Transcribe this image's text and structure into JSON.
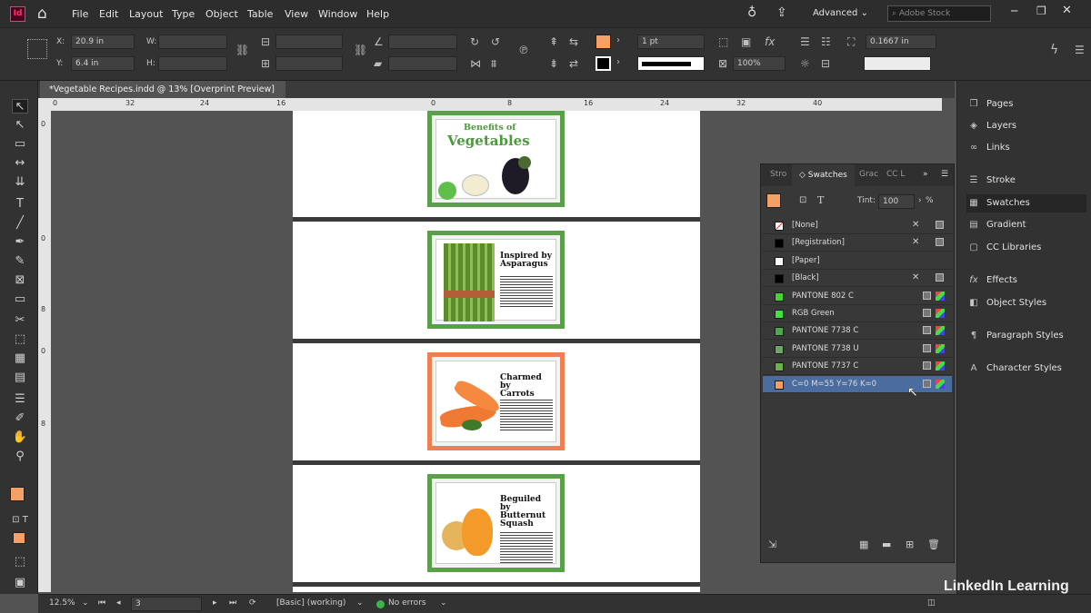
{
  "menubar": {
    "app_icon": "Id",
    "items": [
      "File",
      "Edit",
      "Layout",
      "Type",
      "Object",
      "Table",
      "View",
      "Window",
      "Help"
    ],
    "workspace": "Advanced",
    "search_placeholder": "Adobe Stock"
  },
  "control": {
    "x_label": "X:",
    "x_value": "20.9 in",
    "y_label": "Y:",
    "y_value": "6.4 in",
    "w_label": "W:",
    "h_label": "H:",
    "stroke_weight": "1 pt",
    "opacity": "100%",
    "inset": "0.1667 in",
    "fill_color": "#f7a066"
  },
  "document_tab": {
    "title": "*Vegetable Recipes.indd @ 13% [Overprint Preview]",
    "close": "×"
  },
  "ruler_h": [
    "0",
    "32",
    "24",
    "16",
    "0",
    "8",
    "16",
    "24",
    "32",
    "40"
  ],
  "ruler_v": [
    "0",
    "0",
    "8",
    "0",
    "8"
  ],
  "pages": [
    {
      "title_line1": "Benefits of",
      "title_line2": "Vegetables",
      "border": "#5aa04a"
    },
    {
      "title": "Inspired by Asparagus",
      "border": "#5aa04a"
    },
    {
      "title": "Charmed by Carrots",
      "border": "#ee7f50"
    },
    {
      "title": "Beguiled by Butternut Squash",
      "border": "#5aa04a"
    }
  ],
  "panel": {
    "tabs": [
      "Stro",
      "Swatches",
      "Grac",
      "CC L"
    ],
    "tint_label": "Tint:",
    "tint_value": "100",
    "tint_unit": "%",
    "swatches": [
      {
        "name": "[None]",
        "color": "#ffffff"
      },
      {
        "name": "[Registration]",
        "color": "#000000"
      },
      {
        "name": "[Paper]",
        "color": "#ffffff"
      },
      {
        "name": "[Black]",
        "color": "#000000"
      },
      {
        "name": "PANTONE 802 C",
        "color": "#44d62c"
      },
      {
        "name": "RGB Green",
        "color": "#3fe23f"
      },
      {
        "name": "PANTONE 7738 C",
        "color": "#4ba84b"
      },
      {
        "name": "PANTONE 7738 U",
        "color": "#6aa86a"
      },
      {
        "name": "PANTONE 7737 C",
        "color": "#6bb04a"
      },
      {
        "name": "C=0 M=55 Y=76 K=0",
        "color": "#f7a066",
        "selected": true
      }
    ]
  },
  "dock": {
    "items": [
      "Pages",
      "Layers",
      "Links",
      "Stroke",
      "Swatches",
      "Gradient",
      "CC Libraries",
      "Effects",
      "Object Styles",
      "Paragraph Styles",
      "Character Styles"
    ]
  },
  "status": {
    "zoom": "12.5%",
    "page": "3",
    "style": "[Basic] (working)",
    "errors": "No errors"
  },
  "watermark": {
    "brand": "LinkedIn Learning",
    "in_letters": "in"
  }
}
